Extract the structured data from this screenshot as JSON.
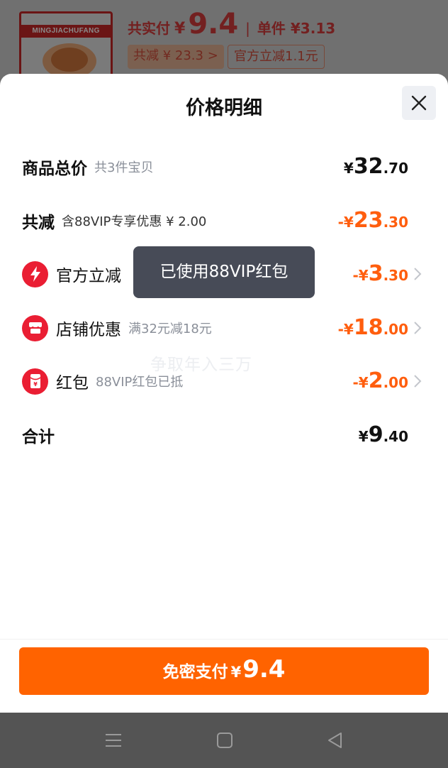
{
  "background": {
    "brand": "MINGJIACHUFANG",
    "pay_label": "共实付",
    "pay_currency": "¥",
    "pay_amount": "9.4",
    "separator": "|",
    "unit_price": "单件 ¥3.13",
    "tag_discount": "共减 ¥ 23.3 >",
    "tag_official": "官方立减1.1元"
  },
  "sheet": {
    "title": "价格明细",
    "close_icon": "close-icon",
    "rows": [
      {
        "label": "商品总价",
        "sub": "共3件宝贝",
        "sign": "¥",
        "int": "32",
        "dec": ".70"
      },
      {
        "label": "共减",
        "sub": "含88VIP专享优惠 ¥ 2.00",
        "sign": "-¥",
        "int": "23",
        "dec": ".30"
      },
      {
        "label": "官方立减",
        "icon": "lightning-icon",
        "sub": "",
        "sign": "-¥",
        "int": "3",
        "dec": ".30"
      },
      {
        "label": "店铺优惠",
        "icon": "shop-icon",
        "sub": "满32元减18元",
        "sign": "-¥",
        "int": "18",
        "dec": ".00"
      },
      {
        "label": "红包",
        "icon": "red-packet-icon",
        "sub": "88VIP红包已抵",
        "sign": "-¥",
        "int": "2",
        "dec": ".00"
      },
      {
        "label": "合计",
        "sub": "",
        "sign": "¥",
        "int": "9",
        "dec": ".40"
      }
    ],
    "toast": "已使用88VIP红包",
    "watermark": "争取年入三万",
    "pay_button": {
      "label": "免密支付",
      "currency": "¥",
      "amount": "9.4"
    }
  },
  "colors": {
    "accent_orange": "#ff6300",
    "discount_orange": "#ff5e0e",
    "icon_red": "#ea1e33"
  },
  "navbar": {
    "icons": [
      "menu-icon",
      "home-square-icon",
      "back-triangle-icon"
    ]
  }
}
